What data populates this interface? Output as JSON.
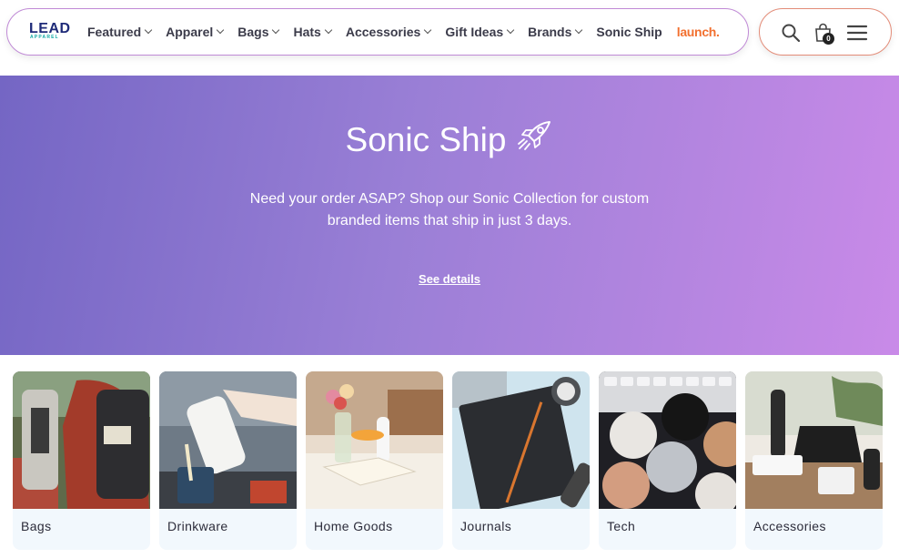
{
  "brand": {
    "logo_text": "LEAD",
    "logo_sub": "APPAREL"
  },
  "nav": {
    "items": [
      {
        "label": "Featured",
        "dropdown": true
      },
      {
        "label": "Apparel",
        "dropdown": true
      },
      {
        "label": "Bags",
        "dropdown": true
      },
      {
        "label": "Hats",
        "dropdown": true
      },
      {
        "label": "Accessories",
        "dropdown": true
      },
      {
        "label": "Gift Ideas",
        "dropdown": true
      },
      {
        "label": "Brands",
        "dropdown": true
      },
      {
        "label": "Sonic Ship",
        "dropdown": false
      }
    ],
    "launch_label": "launch."
  },
  "header_icons": {
    "search": "search-icon",
    "cart": "cart-icon",
    "menu": "hamburger-icon",
    "cart_count": "0"
  },
  "hero": {
    "title": "Sonic Ship",
    "icon": "rocket-icon",
    "description": "Need your order ASAP? Shop our Sonic Collection for custom branded items that ship in just 3 days.",
    "link": "See details"
  },
  "categories": [
    {
      "label": "Bags"
    },
    {
      "label": "Drinkware"
    },
    {
      "label": "Home Goods"
    },
    {
      "label": "Journals"
    },
    {
      "label": "Tech"
    },
    {
      "label": "Accessories"
    }
  ],
  "colors": {
    "accent_orange": "#f2702f",
    "logo_navy": "#1e2a78",
    "logo_teal": "#1aa7a0",
    "hero_start": "#7466c4",
    "hero_end": "#c98ae8"
  }
}
